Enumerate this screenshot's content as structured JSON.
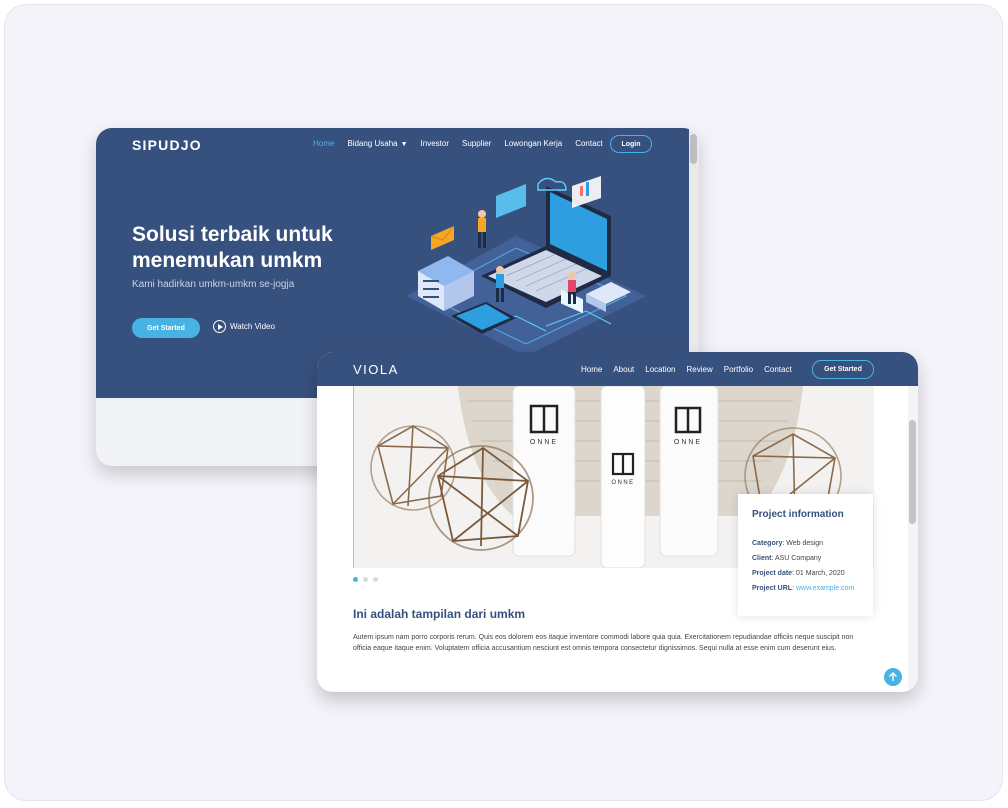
{
  "sipudjo": {
    "logo": "SIPUDJO",
    "nav": [
      "Home",
      "Bidang Usaha",
      "Investor",
      "Supplier",
      "Lowongan Kerja",
      "Contact"
    ],
    "login": "Login",
    "title": "Solusi terbaik untuk menemukan umkm",
    "subtitle": "Kami hadirkan umkm-umkm se-jogja",
    "get_started": "Get Started",
    "watch_video": "Watch Video"
  },
  "viola": {
    "logo": "VIOLA",
    "nav": [
      "Home",
      "About",
      "Location",
      "Review",
      "Portfolio",
      "Contact"
    ],
    "get_started": "Get Started",
    "product_brand": "ONNE",
    "info": {
      "title": "Project information",
      "category_label": "Category",
      "category": "Web design",
      "client_label": "Client",
      "client": "ASU Company",
      "date_label": "Project date",
      "date": "01 March, 2020",
      "url_label": "Project URL",
      "url": "www.example.com"
    },
    "heading": "Ini adalah tampilan dari umkm",
    "body": "Autem ipsum nam porro corporis rerum. Quis eos dolorem eos itaque inventore commodi labore quia quia. Exercitationem repudiandae officiis neque suscipit non officia eaque itaque enim. Voluptatem officia accusantium nesciunt est omnis tempora consectetur dignissimos. Sequi nulla at esse enim cum deserunt eius."
  },
  "colors": {
    "brand": "#37517e",
    "accent": "#47b2e4",
    "canvas": "#f5f3fa"
  }
}
